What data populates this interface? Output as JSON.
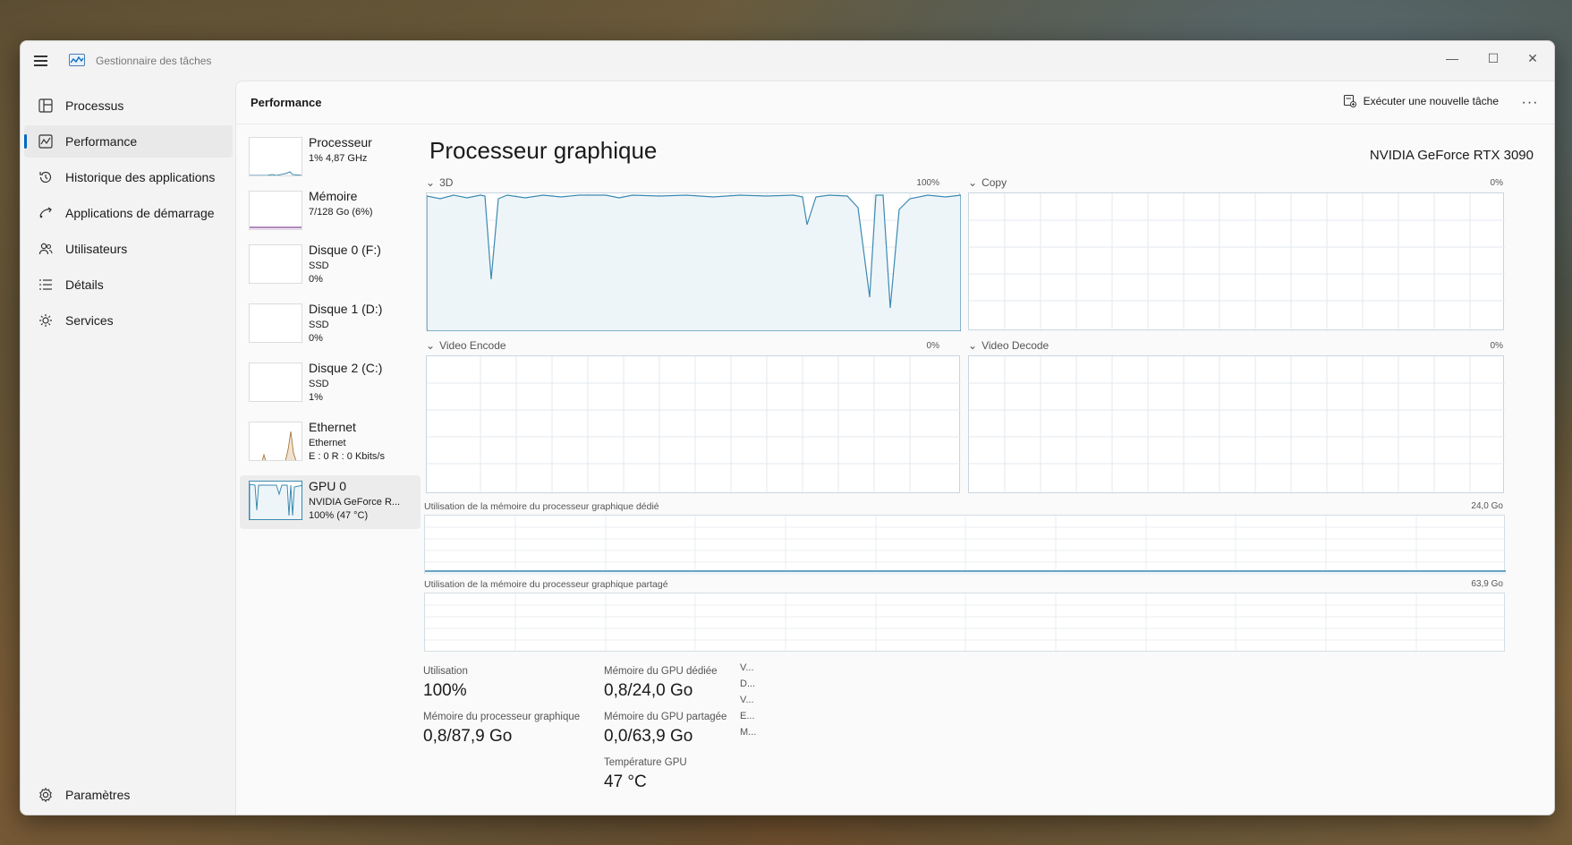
{
  "app": {
    "title": "Gestionnaire des tâches"
  },
  "window_controls": {
    "minimize": "—",
    "maximize": "☐",
    "close": "✕"
  },
  "nav": {
    "items": [
      {
        "label": "Processus",
        "icon": "processes-icon"
      },
      {
        "label": "Performance",
        "icon": "performance-icon"
      },
      {
        "label": "Historique des applications",
        "icon": "history-icon"
      },
      {
        "label": "Applications de démarrage",
        "icon": "startup-icon"
      },
      {
        "label": "Utilisateurs",
        "icon": "users-icon"
      },
      {
        "label": "Détails",
        "icon": "details-icon"
      },
      {
        "label": "Services",
        "icon": "services-icon"
      }
    ],
    "settings": {
      "label": "Paramètres",
      "icon": "gear-icon"
    }
  },
  "header": {
    "title": "Performance",
    "run_task": "Exécuter une nouvelle tâche",
    "more": "···"
  },
  "devices": [
    {
      "name": "Processeur",
      "line1": "1% 4,87 GHz",
      "line2": ""
    },
    {
      "name": "Mémoire",
      "line1": "7/128 Go (6%)",
      "line2": ""
    },
    {
      "name": "Disque 0 (F:)",
      "line1": "SSD",
      "line2": "0%"
    },
    {
      "name": "Disque 1 (D:)",
      "line1": "SSD",
      "line2": "0%"
    },
    {
      "name": "Disque 2 (C:)",
      "line1": "SSD",
      "line2": "1%"
    },
    {
      "name": "Ethernet",
      "line1": "Ethernet",
      "line2": "E : 0 R : 0 Kbits/s"
    },
    {
      "name": "GPU 0",
      "line1": "NVIDIA GeForce R...",
      "line2": "100% (47 °C)"
    }
  ],
  "gpu": {
    "title": "Processeur graphique",
    "model": "NVIDIA GeForce RTX 3090",
    "engines": [
      {
        "label": "3D",
        "pct": "100%"
      },
      {
        "label": "Copy",
        "pct": "0%"
      },
      {
        "label": "Video Encode",
        "pct": "0%"
      },
      {
        "label": "Video Decode",
        "pct": "0%"
      }
    ],
    "dedicated_mem": {
      "label": "Utilisation de la mémoire du processeur graphique dédié",
      "max": "24,0 Go"
    },
    "shared_mem": {
      "label": "Utilisation de la mémoire du processeur graphique partagé",
      "max": "63,9 Go"
    },
    "stats": {
      "utilisation_label": "Utilisation",
      "utilisation_value": "100%",
      "gpu_mem_label": "Mémoire du processeur graphique",
      "gpu_mem_value": "0,8/87,9 Go",
      "dedicated_label": "Mémoire du GPU dédiée",
      "dedicated_value": "0,8/24,0 Go",
      "shared_label": "Mémoire du GPU partagée",
      "shared_value": "0,0/63,9 Go",
      "temp_label": "Température GPU",
      "temp_value": "47 °C",
      "truncated": [
        "V...",
        "D...",
        "V...",
        "E...",
        "M..."
      ]
    }
  },
  "colors": {
    "accent": "#0067c0",
    "gpu_line": "#3a8ab0",
    "gpu_fill": "#eef5f9",
    "mem_line": "#8b4a9c",
    "eth_line": "#a06a2a"
  }
}
